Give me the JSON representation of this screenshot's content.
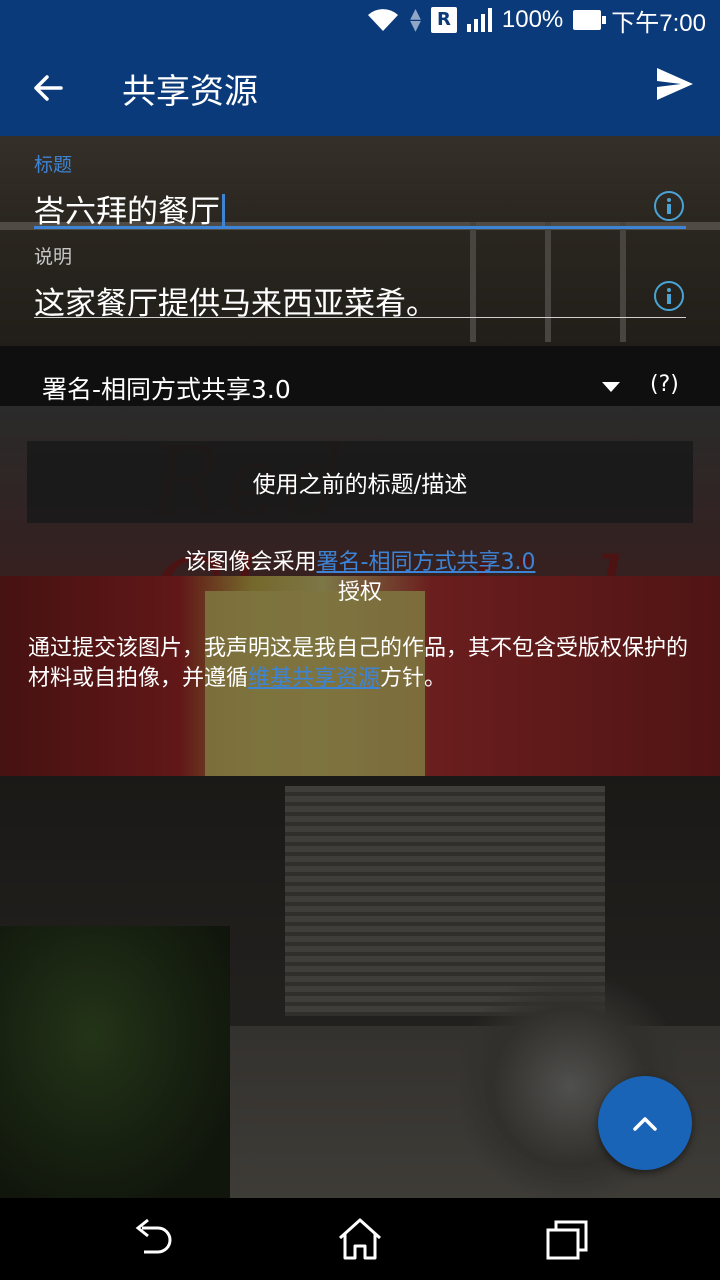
{
  "status_bar": {
    "battery_percent": "100%",
    "time": "下午7:00",
    "network_badge": "R",
    "icons": [
      "wifi-icon",
      "data-arrows-icon",
      "roaming-icon",
      "signal-icon",
      "battery-icon"
    ]
  },
  "app_bar": {
    "title": "共享资源",
    "back_icon": "arrow-left-icon",
    "send_icon": "send-icon",
    "color": "#0a3a7a"
  },
  "form": {
    "title_field": {
      "label": "标题",
      "value": "峇六拜的餐厅"
    },
    "description_field": {
      "label": "说明",
      "value": "这家餐厅提供马来西亚菜肴。"
    },
    "license": {
      "selected": "署名-相同方式共享3.0",
      "help": "(?)"
    },
    "previous_button": "使用之前的标题/描述",
    "license_notice": {
      "before": "该图像会采用",
      "link": "署名-相同方式共享3.0",
      "after": "授权"
    },
    "declaration": {
      "before": "通过提交该图片，我声明这是我自己的作品，其不包含受版权保护的材料或自拍像，并遵循",
      "link": "维基共享资源",
      "after": "方针。"
    },
    "accent_color": "#3d84d6"
  },
  "fab": {
    "icon": "chevron-up-icon",
    "color": "#1a64b8"
  },
  "nav_bar": {
    "icons": [
      "back-nav-icon",
      "home-nav-icon",
      "recents-nav-icon"
    ]
  }
}
